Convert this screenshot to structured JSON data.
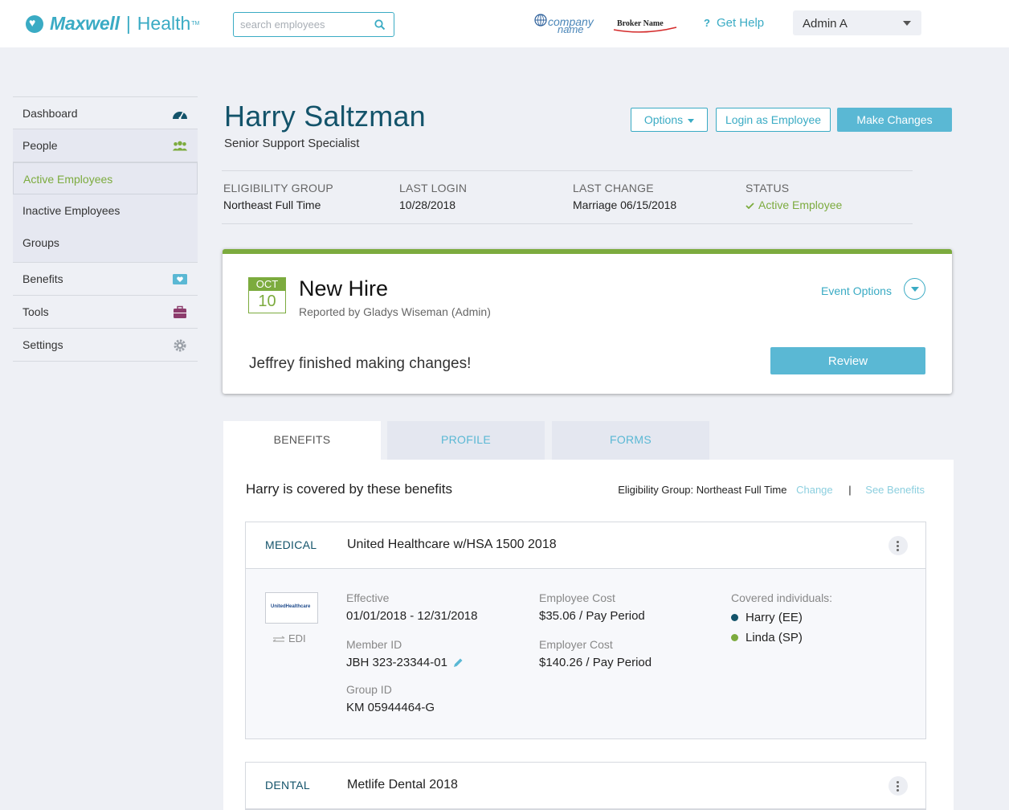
{
  "header": {
    "brand_name": "Maxwell",
    "brand_suffix": "Health",
    "brand_tm": "TM",
    "search_placeholder": "search employees",
    "company_logo_line1": "company",
    "company_logo_line2": "name",
    "broker_logo": "Broker Name",
    "help_icon": "?",
    "help_label": "Get Help",
    "admin_label": "Admin A"
  },
  "sidebar": {
    "dashboard": "Dashboard",
    "people": "People",
    "active_employees": "Active Employees",
    "inactive_employees": "Inactive Employees",
    "groups": "Groups",
    "benefits": "Benefits",
    "tools": "Tools",
    "settings": "Settings"
  },
  "employee": {
    "name": "Harry Saltzman",
    "title": "Senior Support Specialist"
  },
  "actions": {
    "options": "Options",
    "login_as": "Login as Employee",
    "make_changes": "Make Changes"
  },
  "meta": {
    "eligibility_label": "ELIGIBILITY GROUP",
    "eligibility_value": "Northeast Full Time",
    "last_login_label": "LAST LOGIN",
    "last_login_value": "10/28/2018",
    "last_change_label": "LAST CHANGE",
    "last_change_value": "Marriage 06/15/2018",
    "status_label": "STATUS",
    "status_value": "Active Employee"
  },
  "event": {
    "month": "OCT",
    "day": "10",
    "title": "New Hire",
    "reported_by": "Reported by Gladys Wiseman (Admin)",
    "options_label": "Event Options",
    "message": "Jeffrey finished making changes!",
    "review_label": "Review"
  },
  "tabs": {
    "benefits": "BENEFITS",
    "profile": "PROFILE",
    "forms": "FORMS"
  },
  "coverage": {
    "title": "Harry is covered by these benefits",
    "eligibility_text": "Eligibility Group: Northeast Full Time",
    "change_link": "Change",
    "separator": "|",
    "see_benefits_link": "See Benefits"
  },
  "medical": {
    "type": "MEDICAL",
    "plan": "United Healthcare w/HSA 1500 2018",
    "carrier_logo": "UnitedHealthcare",
    "edi_label": "EDI",
    "effective_label": "Effective",
    "effective_value": "01/01/2018 - 12/31/2018",
    "member_id_label": "Member ID",
    "member_id_value": "JBH 323-23344-01",
    "group_id_label": "Group ID",
    "group_id_value": "KM 05944464-G",
    "employee_cost_label": "Employee Cost",
    "employee_cost_value": "$35.06 / Pay Period",
    "employer_cost_label": "Employer Cost",
    "employer_cost_value": "$140.26 / Pay Period",
    "covered_label": "Covered individuals:",
    "covered": [
      {
        "name": "Harry (EE)",
        "color": "#13536a"
      },
      {
        "name": "Linda (SP)",
        "color": "#7cab3e"
      }
    ]
  },
  "dental": {
    "type": "DENTAL",
    "plan": "Metlife Dental 2018"
  },
  "colors": {
    "brand": "#3aabc4",
    "navy": "#13536a",
    "green": "#7cab3e",
    "button_fill": "#5ab8d4",
    "background": "#eef0f5"
  }
}
